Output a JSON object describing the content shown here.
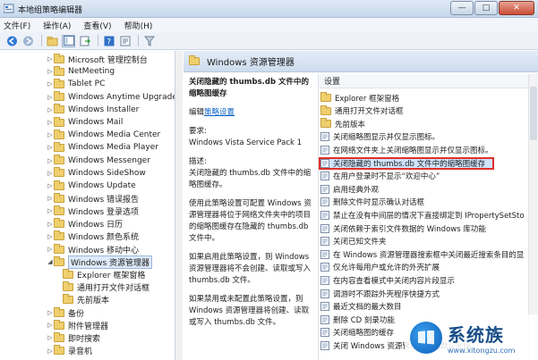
{
  "window": {
    "title": "本地组策略编辑器",
    "buttons": {
      "minimize": "—",
      "maximize": "□",
      "close": "✕"
    }
  },
  "menu": [
    "文件(F)",
    "操作(A)",
    "查看(V)",
    "帮助(H)"
  ],
  "toolbar": {
    "icons": [
      "back-icon",
      "forward-icon",
      "up-folder-icon",
      "show-tree-icon",
      "export-icon",
      "help-icon",
      "properties-icon",
      "filter-icon"
    ]
  },
  "tree": {
    "items": [
      {
        "label": "Microsoft 管理控制台",
        "expanded": false
      },
      {
        "label": "NetMeeting",
        "expanded": false
      },
      {
        "label": "Tablet PC",
        "expanded": false
      },
      {
        "label": "Windows Anytime Upgrade",
        "expanded": false
      },
      {
        "label": "Windows Installer",
        "expanded": false
      },
      {
        "label": "Windows Mail",
        "expanded": false
      },
      {
        "label": "Windows Media Center",
        "expanded": false
      },
      {
        "label": "Windows Media Player",
        "expanded": false
      },
      {
        "label": "Windows Messenger",
        "expanded": false
      },
      {
        "label": "Windows SideShow",
        "expanded": false
      },
      {
        "label": "Windows Update",
        "expanded": false
      },
      {
        "label": "Windows 错误报告",
        "expanded": false
      },
      {
        "label": "Windows 登录选项",
        "expanded": false
      },
      {
        "label": "Windows 日历",
        "expanded": false
      },
      {
        "label": "Windows 颜色系统",
        "expanded": false
      },
      {
        "label": "Windows 移动中心",
        "expanded": false
      },
      {
        "label": "Windows 资源管理器",
        "expanded": true,
        "selected": true
      },
      {
        "label": "Explorer 框架窗格",
        "child": true
      },
      {
        "label": "通用打开文件对话框",
        "child": true
      },
      {
        "label": "先前版本",
        "child": true
      },
      {
        "label": "备份",
        "expanded": false
      },
      {
        "label": "附件管理器",
        "expanded": false
      },
      {
        "label": "即时搜索",
        "expanded": false
      },
      {
        "label": "录音机",
        "expanded": false
      }
    ]
  },
  "header": {
    "title": "Windows 资源管理器"
  },
  "description": {
    "policy_title": "关闭隐藏的 thumbs.db 文件中的缩略图缓存",
    "edit_prefix": "编辑",
    "edit_link": "策略设置",
    "req_label": "要求:",
    "req_value": "Windows Vista Service Pack 1",
    "desc_label": "描述:",
    "desc_value": "关闭隐藏的 thumbs.db 文件中的缩略图缓存。",
    "para1": "使用此策略设置可配置 Windows 资源管理器将位于网络文件夹中的项目的缩略图缓存在隐藏的 thumbs.db 文件中。",
    "para2": "如果启用此策略设置，则 Windows 资源管理器将不会创建、读取或写入 thumbs.db 文件。",
    "para3": "如果禁用或未配置此策略设置，则 Windows 资源管理器将创建、读取或写入 thumbs.db 文件。"
  },
  "settings": {
    "column_header": "设置",
    "items": [
      {
        "label": "Explorer 框架窗格",
        "kind": "folder"
      },
      {
        "label": "通用打开文件对话框",
        "kind": "folder"
      },
      {
        "label": "先前版本",
        "kind": "folder"
      },
      {
        "label": "关闭缩略图显示并仅显示图标。",
        "kind": "policy"
      },
      {
        "label": "在网络文件夹上关闭缩略图显示并仅显示图标。",
        "kind": "policy"
      },
      {
        "label": "关闭隐藏的 thumbs.db 文件中的缩略图缓存",
        "kind": "policy",
        "highlight": true
      },
      {
        "label": "在用户登录时不显示“欢迎中心”",
        "kind": "policy"
      },
      {
        "label": "启用经典外观",
        "kind": "policy"
      },
      {
        "label": "删除文件时显示确认对话框",
        "kind": "policy"
      },
      {
        "label": "禁止在没有中间层的情况下直接绑定到 IPropertySetStorage",
        "kind": "policy"
      },
      {
        "label": "关闭依赖于索引文件数据的 Windows 库功能",
        "kind": "policy"
      },
      {
        "label": "关闭已知文件夹",
        "kind": "policy"
      },
      {
        "label": "在 Windows 资源管理器搜索框中关闭最近搜索条目的显示",
        "kind": "policy"
      },
      {
        "label": "仅允许每用户或允许的外壳扩展",
        "kind": "policy"
      },
      {
        "label": "在内容查看模式中关闭内容片段显示",
        "kind": "policy"
      },
      {
        "label": "调游时不跟踪外壳程序快捷方式",
        "kind": "policy"
      },
      {
        "label": "最近文档的最大数目",
        "kind": "policy"
      },
      {
        "label": "删除 CD 刻录功能",
        "kind": "policy"
      },
      {
        "label": "关闭缩略图的缓存",
        "kind": "policy"
      },
      {
        "label": "关闭 Windows 资源管理器中的默认升级",
        "kind": "policy"
      }
    ]
  },
  "watermark": {
    "cn": "系统族",
    "en": "www.xitongzu.com"
  },
  "colors": {
    "highlight_border": "#e0302b",
    "selection": "#cfe3fb",
    "link": "#0b63c4"
  }
}
